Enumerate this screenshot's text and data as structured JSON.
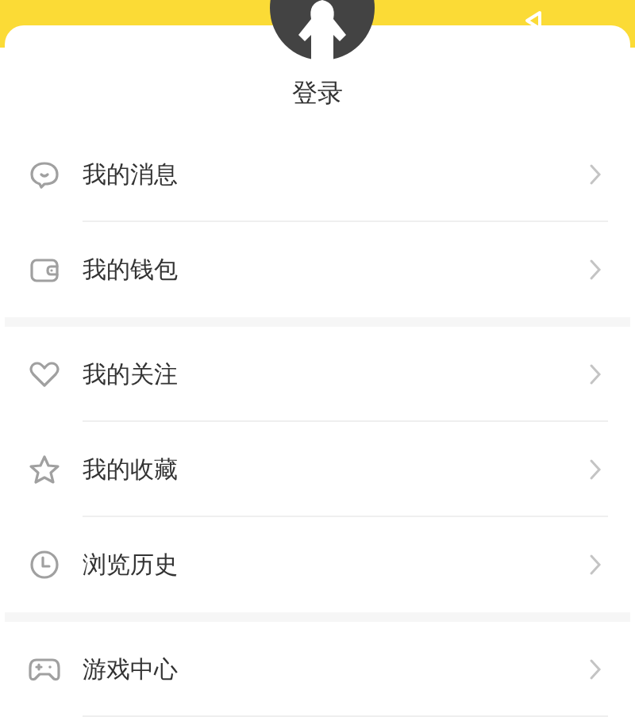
{
  "header": {
    "login_text": "登录"
  },
  "groups": [
    {
      "items": [
        {
          "kind": "message",
          "label": "我的消息"
        },
        {
          "kind": "wallet",
          "label": "我的钱包"
        }
      ]
    },
    {
      "items": [
        {
          "kind": "heart",
          "label": "我的关注"
        },
        {
          "kind": "star",
          "label": "我的收藏"
        },
        {
          "kind": "clock",
          "label": "浏览历史"
        }
      ]
    },
    {
      "items": [
        {
          "kind": "gamepad",
          "label": "游戏中心"
        }
      ]
    }
  ]
}
